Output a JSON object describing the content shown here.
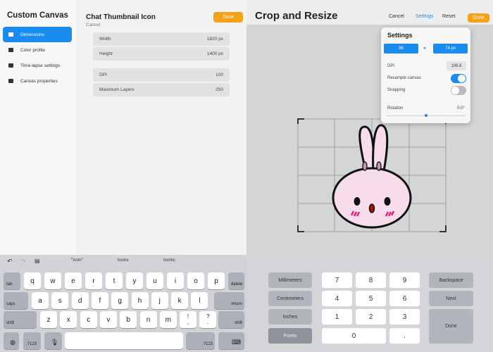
{
  "left": {
    "sidebar": {
      "title": "Custom Canvas",
      "items": [
        {
          "label": "Dimensions",
          "icon": "crop-icon"
        },
        {
          "label": "Color profile",
          "icon": "document-icon"
        },
        {
          "label": "Time-lapse settings",
          "icon": "video-camera-icon"
        },
        {
          "label": "Canvas properties",
          "icon": "canvas-icon"
        }
      ]
    },
    "title": "Chat Thumbnail Icon",
    "cancel": "Cancel",
    "save": "Save",
    "fields": [
      {
        "label": "Width",
        "value": "1820 px"
      },
      {
        "label": "Height",
        "value": "1400 px"
      },
      {
        "label": "DPI",
        "value": "100"
      },
      {
        "label": "Maximum Layers",
        "value": "250"
      }
    ]
  },
  "keyboard": {
    "suggestions": [
      "\"Icon\"",
      "Icons",
      "Iconic"
    ],
    "row1": [
      "q",
      "w",
      "e",
      "r",
      "t",
      "y",
      "u",
      "i",
      "o",
      "p"
    ],
    "row2": [
      "a",
      "s",
      "d",
      "f",
      "g",
      "h",
      "j",
      "k",
      "l"
    ],
    "row3": [
      "z",
      "x",
      "c",
      "v",
      "b",
      "n",
      "m",
      "!",
      ",",
      "?",
      "."
    ],
    "tab": "tab",
    "delete": "delete",
    "caps": "caps",
    "return": "return",
    "shift": "shift",
    "numbers": ".?123"
  },
  "right": {
    "title": "Crop and Resize",
    "cancel": "Cancel",
    "settings": "Settings",
    "reset": "Reset",
    "done": "Done",
    "popover": {
      "title": "Settings",
      "width": "96",
      "height": "74 px",
      "dpi_label": "DPI",
      "dpi": "106.6",
      "resample_label": "Resample canvas",
      "resample": true,
      "snapping_label": "Snapping",
      "snapping": false,
      "rotation_label": "Rotation",
      "rotation": "0.0°"
    },
    "numpad": {
      "units": [
        "Millimeters",
        "Centimeters",
        "Inches",
        "Pixels"
      ],
      "selected_unit": "Pixels",
      "digits": [
        "7",
        "8",
        "9",
        "4",
        "5",
        "6",
        "1",
        "2",
        "3",
        "0",
        "."
      ],
      "backspace": "Backspace",
      "next": "Next",
      "done": "Done"
    }
  },
  "colors": {
    "accent": "#1a8cf0",
    "orange": "#f5a21b"
  }
}
